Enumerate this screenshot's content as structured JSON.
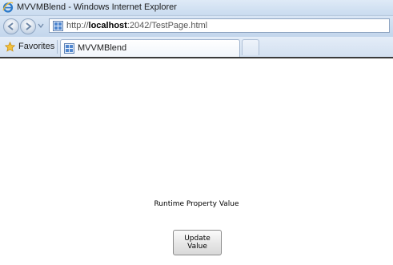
{
  "window": {
    "title": "MVVMBlend - Windows Internet Explorer"
  },
  "address_bar": {
    "url_host": "localhost",
    "url_prefix": "http://",
    "url_suffix": ":2042/TestPage.html"
  },
  "favorites": {
    "label": "Favorites"
  },
  "tabs": [
    {
      "label": "MVVMBlend",
      "active": true
    }
  ],
  "page": {
    "runtime_label": "Runtime Property Value",
    "update_button_label": "Update Value"
  },
  "icons": {
    "browser_logo": "ie-logo-icon",
    "back": "back-arrow-icon",
    "forward": "forward-arrow-icon",
    "page": "page-icon",
    "favorites": "star-icon"
  },
  "colors": {
    "chrome_blue": "#c9dbef",
    "button_gray": "#e6e6e6"
  }
}
